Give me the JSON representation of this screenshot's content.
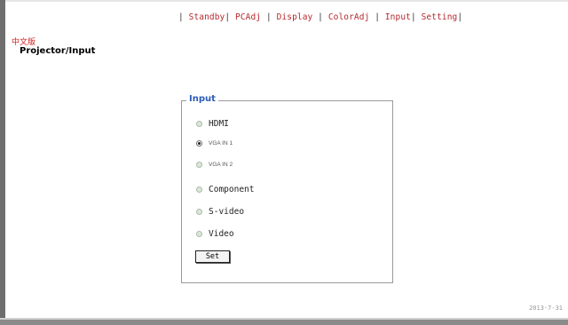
{
  "nav": {
    "items": [
      {
        "label": "Standby"
      },
      {
        "label": "PCAdj"
      },
      {
        "label": "Display"
      },
      {
        "label": "ColorAdj"
      },
      {
        "label": "Input"
      },
      {
        "label": "Setting"
      }
    ]
  },
  "language_link": "中文版",
  "breadcrumb": "Projector/Input",
  "input_panel": {
    "legend": "Input",
    "options": [
      {
        "label": "HDMI",
        "selected": false
      },
      {
        "label": "VGA IN 1",
        "selected": true
      },
      {
        "label": "VGA IN 2",
        "selected": false
      },
      {
        "label": "Component",
        "selected": false
      },
      {
        "label": "S-video",
        "selected": false
      },
      {
        "label": "Video",
        "selected": false
      }
    ],
    "set_label": "Set"
  },
  "footer": {
    "date": "2013-7-31"
  },
  "colors": {
    "nav_link": "#b5282e",
    "legend": "#2c5bb8",
    "language_link": "#d21f1f"
  }
}
